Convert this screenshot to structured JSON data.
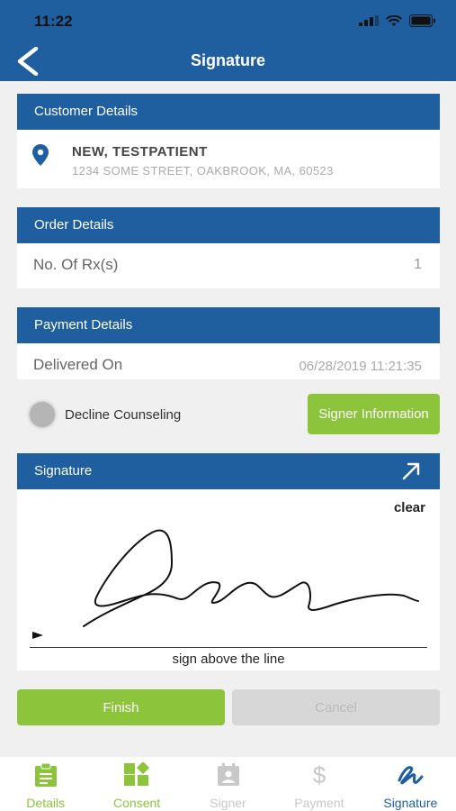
{
  "status": {
    "time": "11:22"
  },
  "nav": {
    "title": "Signature"
  },
  "customer": {
    "header": "Customer Details",
    "name": "NEW, TESTPATIENT",
    "address": "1234 SOME STREET, OAKBROOK, MA, 60523"
  },
  "order": {
    "header": "Order Details",
    "label": "No. Of Rx(s)",
    "value": "1"
  },
  "payment": {
    "header": "Payment Details",
    "label": "Delivered On",
    "value": "06/28/2019 11:21:35"
  },
  "decline": {
    "label": "Decline Counseling",
    "checked": false
  },
  "signer_button": "Signer Information",
  "signature": {
    "header": "Signature",
    "clear_label": "clear",
    "hint": "sign above the line"
  },
  "actions": {
    "finish": "Finish",
    "cancel": "Cancel"
  },
  "tabs": [
    {
      "label": "Details",
      "icon": "clipboard-icon",
      "state": "enabled"
    },
    {
      "label": "Consent",
      "icon": "consent-icon",
      "state": "enabled"
    },
    {
      "label": "Signer",
      "icon": "id-card-icon",
      "state": "disabled"
    },
    {
      "label": "Payment",
      "icon": "dollar-icon",
      "state": "disabled"
    },
    {
      "label": "Signature",
      "icon": "signature-icon",
      "state": "active"
    }
  ],
  "colors": {
    "primary_blue": "#1f5fa0",
    "accent_green": "#8cc43c",
    "active_tab": "#1f5fa0",
    "disabled_tab": "#c8c8c8"
  }
}
